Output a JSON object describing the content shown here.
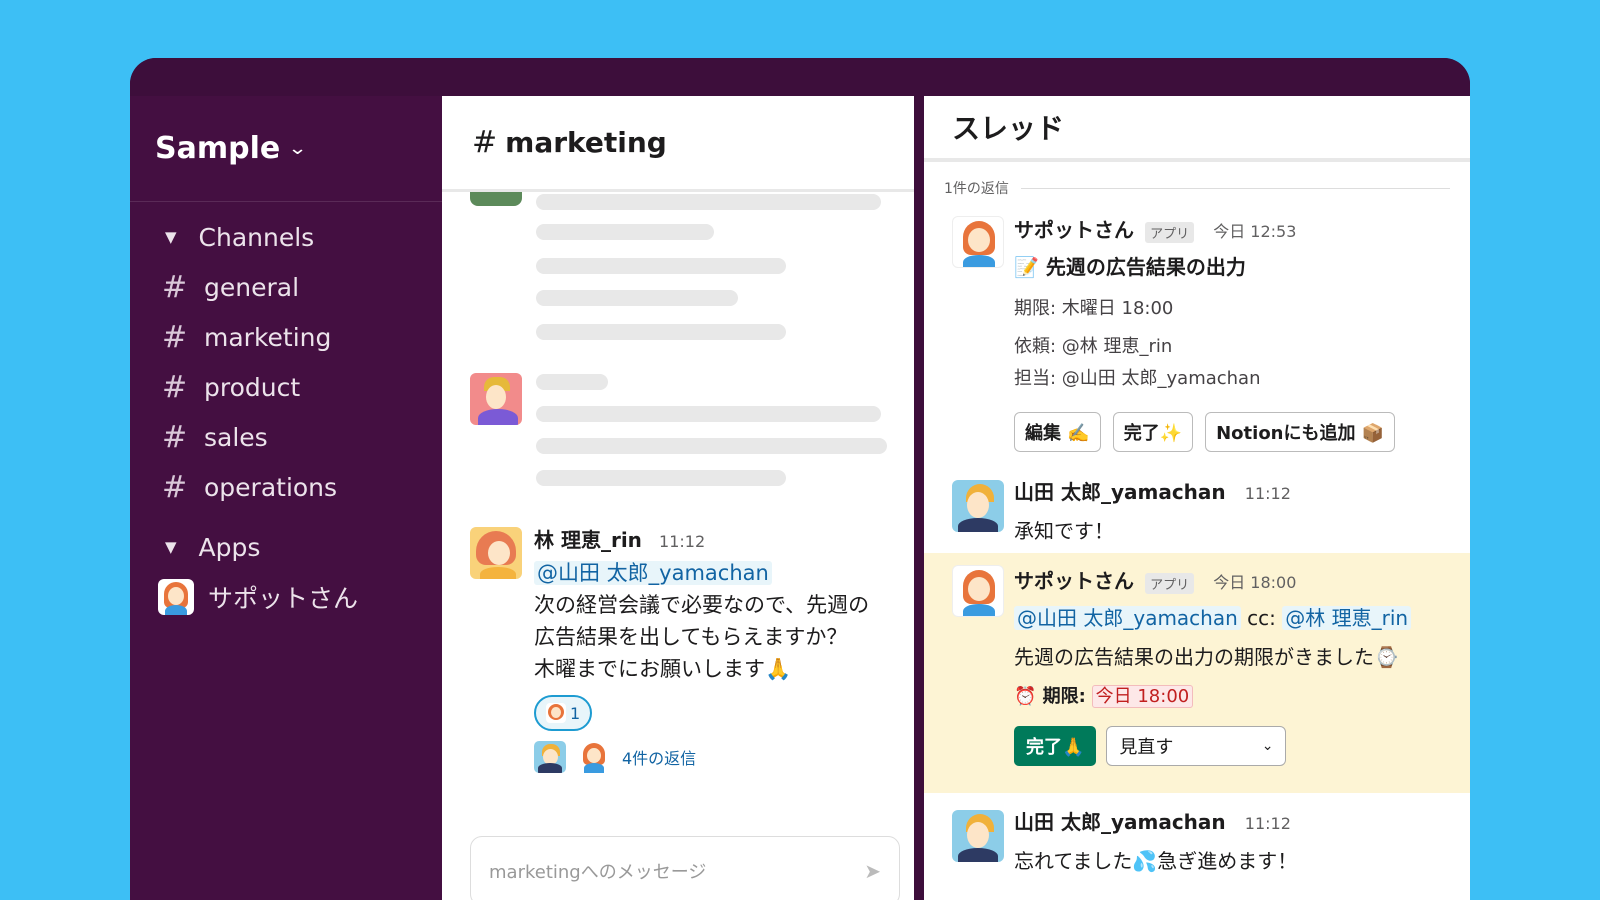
{
  "workspace": {
    "name": "Sample"
  },
  "sidebar": {
    "channels_heading": "Channels",
    "channels": [
      {
        "label": "general"
      },
      {
        "label": "marketing"
      },
      {
        "label": "product"
      },
      {
        "label": "sales"
      },
      {
        "label": "operations"
      }
    ],
    "apps_heading": "Apps",
    "apps": [
      {
        "label": "サポットさん"
      }
    ]
  },
  "channel": {
    "name": "marketing",
    "message": {
      "author": "林 理恵_rin",
      "time": "11:12",
      "mention": "@山田 太郎_yamachan",
      "line1": "次の経営会議で必要なので、先週の",
      "line2": "広告結果を出してもらえますか？",
      "line3": "木曜までにお願いします🙏",
      "reaction_count": "1",
      "replies_link": "4件の返信"
    },
    "composer_placeholder": "marketingへのメッセージ"
  },
  "thread": {
    "title": "スレッド",
    "reply_count": "1件の返信",
    "msg1": {
      "author": "サポットさん",
      "badge": "アプリ",
      "time": "今日 12:53",
      "title": "📝 先週の広告結果の出力",
      "deadline": "期限: 木曜日 18:00",
      "requester": "依頼: @林 理恵_rin",
      "assignee": "担当: @山田 太郎_yamachan",
      "btn_edit": "編集 ✍️",
      "btn_done": "完了✨",
      "btn_notion": "Notionにも追加 📦"
    },
    "msg2": {
      "author": "山田 太郎_yamachan",
      "time": "11:12",
      "text": "承知です！"
    },
    "msg3": {
      "author": "サポットさん",
      "badge": "アプリ",
      "time": "今日 18:00",
      "mention1": "@山田 太郎_yamachan",
      "cc": "cc:",
      "mention2": "@林 理恵_rin",
      "text": "先週の広告結果の出力の期限がきました⌚",
      "deadline_label": "⏰ 期限:",
      "deadline_value": "今日 18:00",
      "btn_done": "完了🙏",
      "select_value": "見直す"
    },
    "msg4": {
      "author": "山田 太郎_yamachan",
      "time": "11:12",
      "text": "忘れてました💦急ぎ進めます！"
    }
  },
  "colors": {
    "accent_green": "#007a5a",
    "sidebar_bg": "#440f41",
    "background": "#3dbff5",
    "link": "#1264a3"
  }
}
